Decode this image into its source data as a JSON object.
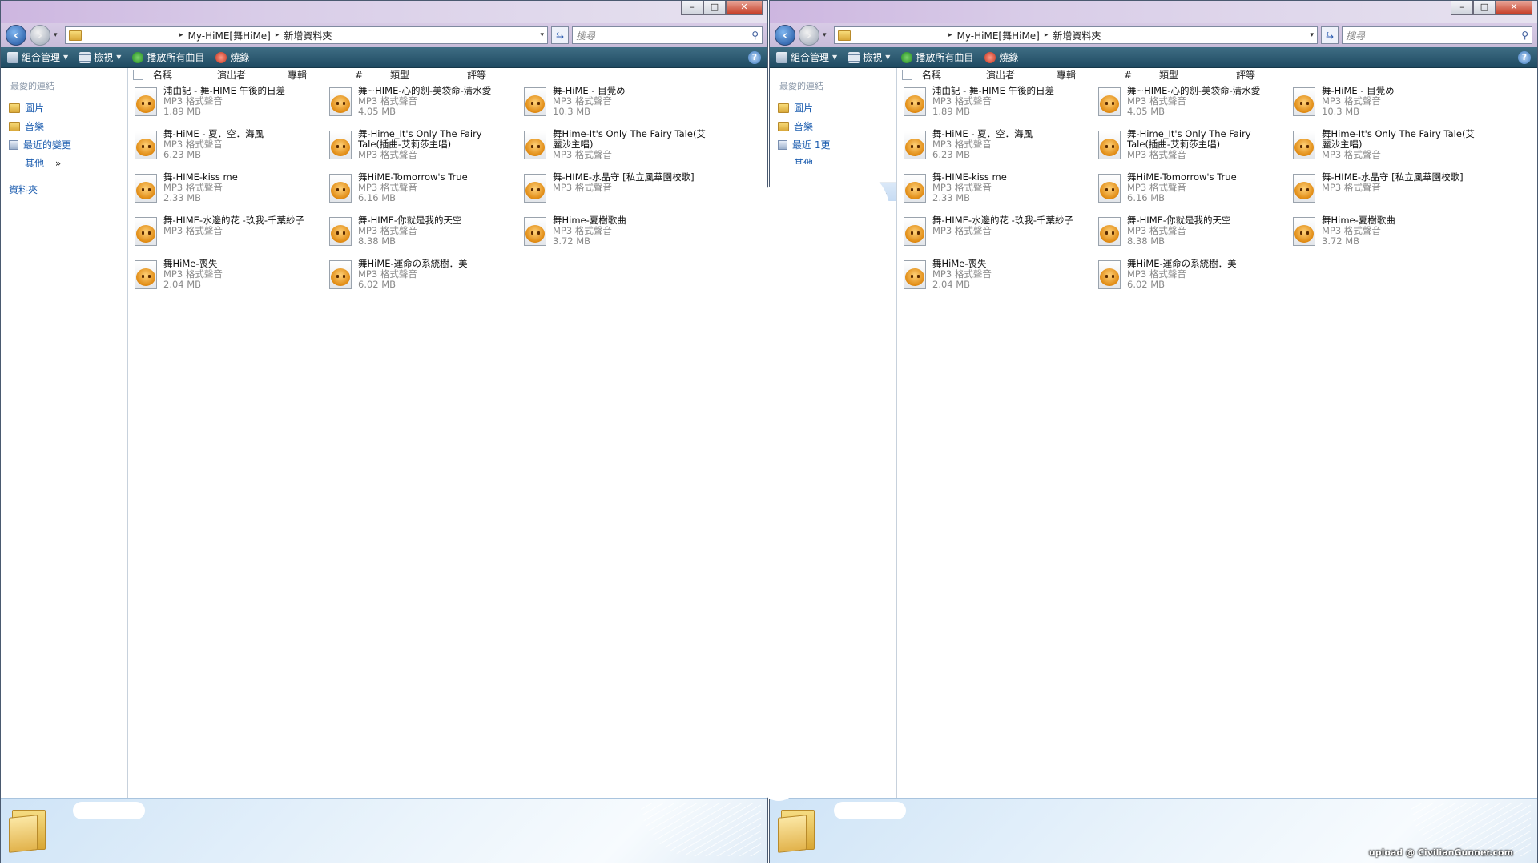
{
  "address": {
    "crumb1": "My-HiME[舞HiMe]",
    "crumb2": "新增資料夾"
  },
  "search": {
    "placeholder": "搜尋"
  },
  "toolbar": {
    "organize": "組合管理",
    "views": "檢視",
    "play_all": "播放所有曲目",
    "burn": "燒錄",
    "help": "?"
  },
  "nav": {
    "favorites_header": "最愛的連結",
    "pictures": "圖片",
    "music": "音樂",
    "recent": "最近的變更",
    "recent_right": "最近  1更",
    "more": "其他",
    "more_chevron": "»",
    "folders": "資料夾",
    "folders_chevron": "⌄"
  },
  "columns": {
    "name": "名稱",
    "artist": "演出者",
    "album": "專輯",
    "track": "#",
    "type": "類型",
    "rating": "評等"
  },
  "files": [
    {
      "title": "浦由記 - 舞-HIME 午後的日差",
      "type": "MP3 格式聲音",
      "size": "1.89 MB"
    },
    {
      "title": "舞~HIME-心的劍-美袋命-清水愛",
      "type": "MP3 格式聲音",
      "size": "4.05 MB"
    },
    {
      "title": "舞-HiME - 目覺め",
      "type": "MP3 格式聲音",
      "size": "10.3 MB"
    },
    {
      "title": "舞-HiME - 夏．空．海風",
      "type": "MP3 格式聲音",
      "size": "6.23 MB"
    },
    {
      "title": "舞-Hime_It's Only The Fairy Tale(插曲-艾莉莎主唱)",
      "type": "MP3 格式聲音",
      "size": ""
    },
    {
      "title": "舞Hime-It's Only The Fairy Tale(艾麗沙主唱)",
      "type": "MP3 格式聲音",
      "size": ""
    },
    {
      "title": "舞-HIME-kiss me",
      "type": "MP3 格式聲音",
      "size": "2.33 MB"
    },
    {
      "title": "舞HiME-Tomorrow's True",
      "type": "MP3 格式聲音",
      "size": "6.16 MB"
    },
    {
      "title": "舞-HIME-水晶守 [私立風華園校歌]",
      "type": "MP3 格式聲音",
      "size": ""
    },
    {
      "title": "舞-HIME-水邊的花 -玖我-千葉紗子",
      "type": "MP3 格式聲音",
      "size": ""
    },
    {
      "title": "舞-HIME-你就是我的天空",
      "type": "MP3 格式聲音",
      "size": "8.38 MB"
    },
    {
      "title": "舞Hime-夏樹歌曲",
      "type": "MP3 格式聲音",
      "size": "3.72 MB"
    },
    {
      "title": "舞HiMe-喪失",
      "type": "MP3 格式聲音",
      "size": "2.04 MB"
    },
    {
      "title": "舞HiME-運命の系統樹．美",
      "type": "MP3 格式聲音",
      "size": "6.02 MB"
    }
  ],
  "window_buttons": {
    "minimize": "–",
    "maximize": "□",
    "close": "✕"
  },
  "watermark": "upload @ CivilianGunner.com"
}
